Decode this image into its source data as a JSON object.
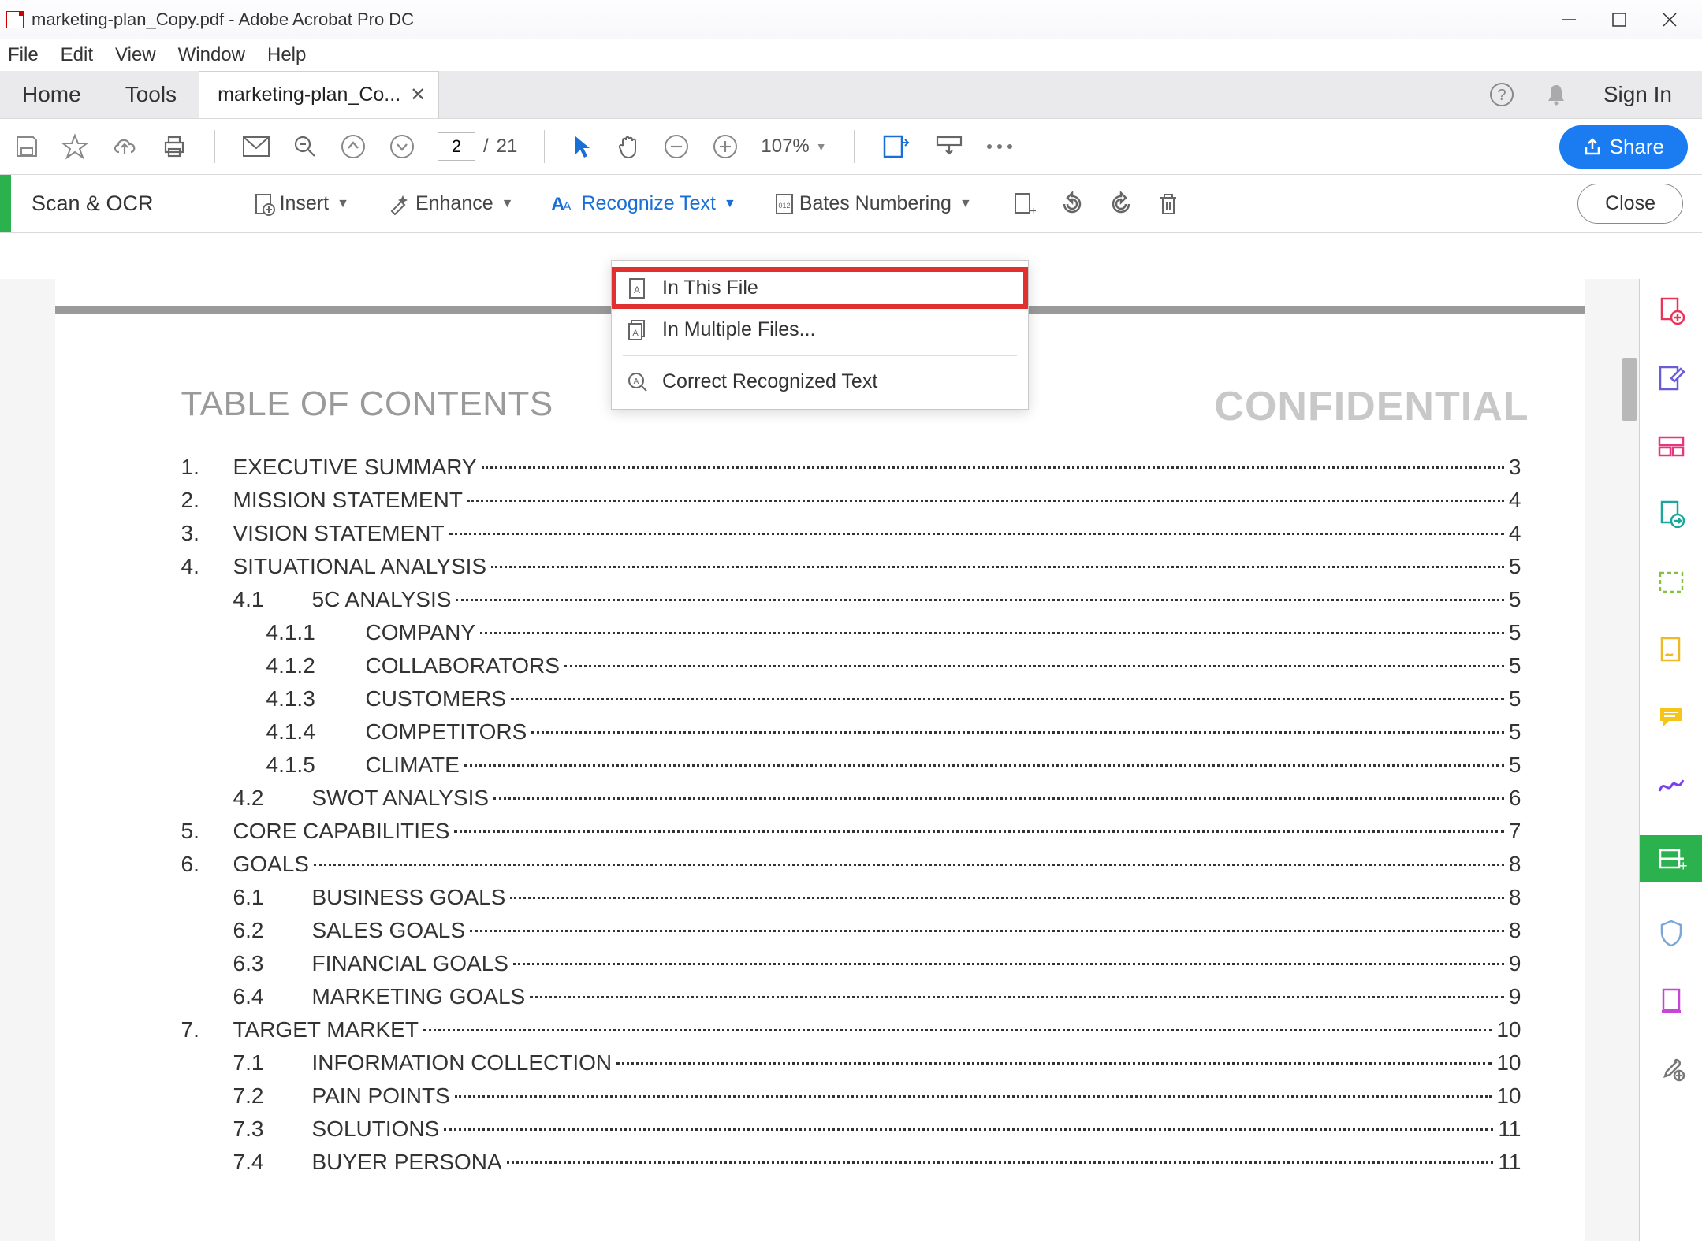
{
  "window": {
    "title": "marketing-plan_Copy.pdf - Adobe Acrobat Pro DC"
  },
  "menu": {
    "file": "File",
    "edit": "Edit",
    "view": "View",
    "window": "Window",
    "help": "Help"
  },
  "nav": {
    "home": "Home",
    "tools": "Tools",
    "doctab": "marketing-plan_Co...",
    "signin": "Sign In"
  },
  "toolbar": {
    "page": "2",
    "pages_total": "21",
    "zoom": "107%",
    "share": "Share"
  },
  "ocr": {
    "label": "Scan & OCR",
    "insert": "Insert",
    "enhance": "Enhance",
    "recognize": "Recognize Text",
    "bates": "Bates Numbering",
    "close": "Close"
  },
  "dd": {
    "inthis": "In This File",
    "multi": "In Multiple Files...",
    "correct": "Correct Recognized Text"
  },
  "doc": {
    "watermark": "CONFIDENTIAL",
    "toc_title": "TABLE OF CONTENTS",
    "rows": [
      {
        "lvl": 1,
        "n": "1.",
        "t": "EXECUTIVE SUMMARY",
        "p": "3"
      },
      {
        "lvl": 1,
        "n": "2.",
        "t": "MISSION STATEMENT",
        "p": "4"
      },
      {
        "lvl": 1,
        "n": "3.",
        "t": "VISION STATEMENT",
        "p": "4"
      },
      {
        "lvl": 1,
        "n": "4.",
        "t": "SITUATIONAL ANALYSIS",
        "p": "5"
      },
      {
        "lvl": 2,
        "n": "4.1",
        "t": "5C ANALYSIS",
        "p": "5"
      },
      {
        "lvl": 3,
        "n": "4.1.1",
        "t": "COMPANY",
        "p": "5"
      },
      {
        "lvl": 3,
        "n": "4.1.2",
        "t": "COLLABORATORS",
        "p": "5"
      },
      {
        "lvl": 3,
        "n": "4.1.3",
        "t": "CUSTOMERS",
        "p": "5"
      },
      {
        "lvl": 3,
        "n": "4.1.4",
        "t": "COMPETITORS",
        "p": "5"
      },
      {
        "lvl": 3,
        "n": "4.1.5",
        "t": "CLIMATE",
        "p": "5"
      },
      {
        "lvl": 2,
        "n": "4.2",
        "t": "SWOT ANALYSIS",
        "p": "6"
      },
      {
        "lvl": 1,
        "n": "5.",
        "t": "CORE CAPABILITIES",
        "p": "7"
      },
      {
        "lvl": 1,
        "n": "6.",
        "t": "GOALS",
        "p": "8"
      },
      {
        "lvl": 2,
        "n": "6.1",
        "t": "BUSINESS GOALS",
        "p": "8"
      },
      {
        "lvl": 2,
        "n": "6.2",
        "t": "SALES GOALS",
        "p": "8"
      },
      {
        "lvl": 2,
        "n": "6.3",
        "t": "FINANCIAL GOALS",
        "p": "9"
      },
      {
        "lvl": 2,
        "n": "6.4",
        "t": "MARKETING GOALS",
        "p": "9"
      },
      {
        "lvl": 1,
        "n": "7.",
        "t": "TARGET MARKET",
        "p": "10"
      },
      {
        "lvl": 2,
        "n": "7.1",
        "t": "INFORMATION COLLECTION",
        "p": "10"
      },
      {
        "lvl": 2,
        "n": "7.2",
        "t": "PAIN POINTS",
        "p": "10"
      },
      {
        "lvl": 2,
        "n": "7.3",
        "t": "SOLUTIONS",
        "p": "11"
      },
      {
        "lvl": 2,
        "n": "7.4",
        "t": "BUYER PERSONA",
        "p": "11"
      }
    ]
  }
}
